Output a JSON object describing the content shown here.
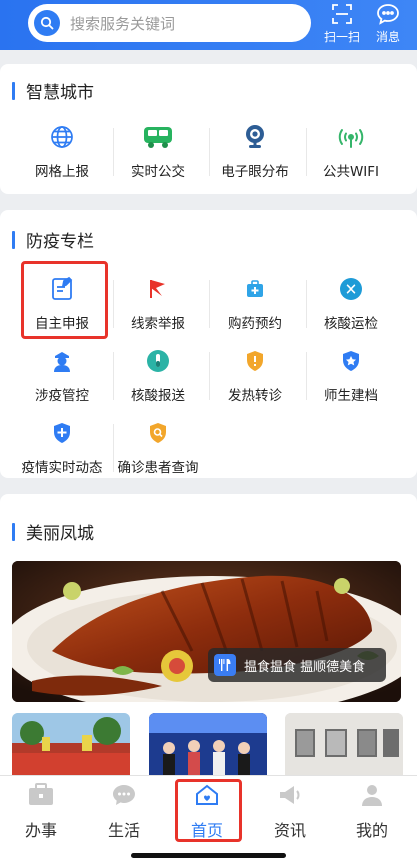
{
  "header": {
    "search_placeholder": "搜索服务关键词",
    "scan_label": "扫一扫",
    "message_label": "消息"
  },
  "smart_city": {
    "title": "智慧城市",
    "items": [
      {
        "label": "网格上报",
        "icon": "globe-icon"
      },
      {
        "label": "实时公交",
        "icon": "bus-icon"
      },
      {
        "label": "电子眼分布",
        "icon": "camera-icon"
      },
      {
        "label": "公共WIFI",
        "icon": "wifi-icon"
      }
    ]
  },
  "epidemic": {
    "title": "防疫专栏",
    "items": [
      {
        "label": "自主申报",
        "icon": "edit-form-icon"
      },
      {
        "label": "线索举报",
        "icon": "flag-icon"
      },
      {
        "label": "购药预约",
        "icon": "medicine-kit-icon"
      },
      {
        "label": "核酸运检",
        "icon": "dna-icon"
      },
      {
        "label": "涉疫管控",
        "icon": "officer-icon"
      },
      {
        "label": "核酸报送",
        "icon": "test-tube-icon"
      },
      {
        "label": "发热转诊",
        "icon": "shield-alert-icon"
      },
      {
        "label": "师生建档",
        "icon": "shield-badge-icon"
      },
      {
        "label": "疫情实时动态",
        "icon": "shield-plus-icon"
      },
      {
        "label": "确诊患者查询",
        "icon": "shield-search-icon"
      }
    ]
  },
  "beautiful_city": {
    "title": "美丽凤城",
    "banner_caption": "揾食揾食 揾顺德美食"
  },
  "tabbar": {
    "items": [
      {
        "label": "办事",
        "icon": "briefcase-icon"
      },
      {
        "label": "生活",
        "icon": "chat-bubble-icon"
      },
      {
        "label": "首页",
        "icon": "home-icon"
      },
      {
        "label": "资讯",
        "icon": "megaphone-icon"
      },
      {
        "label": "我的",
        "icon": "person-icon"
      }
    ],
    "active_index": 2
  },
  "colors": {
    "accent": "#2f7cf3",
    "highlight": "#e8332a"
  }
}
